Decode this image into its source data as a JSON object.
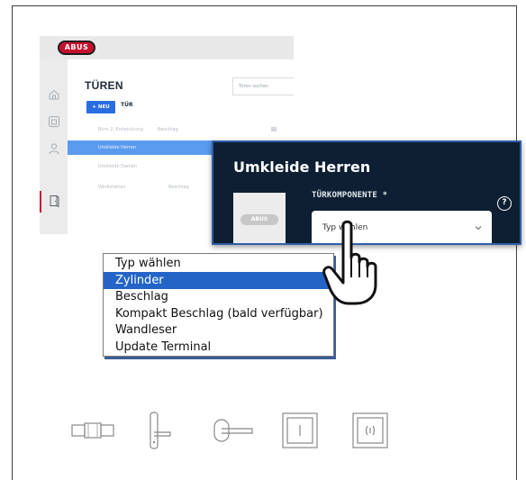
{
  "app": {
    "logo_text": "ABUS",
    "page_title": "TÜREN",
    "search_placeholder": "Türen suchen",
    "new_button_label": "+ NEU",
    "new_button_suffix": "TÜR",
    "rows": [
      {
        "col1": "Büro 2. Entwicklung",
        "col2": "Beschlag",
        "selected": false
      },
      {
        "col1": "Umkleide Herren",
        "col2": "",
        "selected": true
      },
      {
        "col1": "Umkleide Damen",
        "col2": "",
        "selected": false
      },
      {
        "col1": "Werkstätten",
        "col2": "Beschlag",
        "selected": false
      }
    ],
    "sidebar_icons": [
      "home-icon",
      "lock-panel-icon",
      "user-icon",
      "door-icon"
    ]
  },
  "dialog": {
    "title": "Umkleide Herren",
    "field_label": "TÜRKOMPONENTE *",
    "select_value": "Typ wählen",
    "help_label": "?",
    "image_logo": "ABUS"
  },
  "dropdown": {
    "options": [
      {
        "label": "Typ wählen",
        "selected": false
      },
      {
        "label": "Zylinder",
        "selected": true
      },
      {
        "label": "Beschlag",
        "selected": false
      },
      {
        "label": "Kompakt Beschlag (bald verfügbar)",
        "selected": false
      },
      {
        "label": "Wandleser",
        "selected": false
      },
      {
        "label": "Update Terminal",
        "selected": false
      }
    ]
  },
  "component_icons": [
    "cylinder-icon",
    "handle-fitting-icon",
    "compact-fitting-icon",
    "wall-reader-icon",
    "update-terminal-icon"
  ],
  "colors": {
    "brand_red": "#c8102e",
    "dialog_bg": "#0e1f33",
    "selection_blue": "#2464c7",
    "row_selected": "#5b9bef"
  }
}
